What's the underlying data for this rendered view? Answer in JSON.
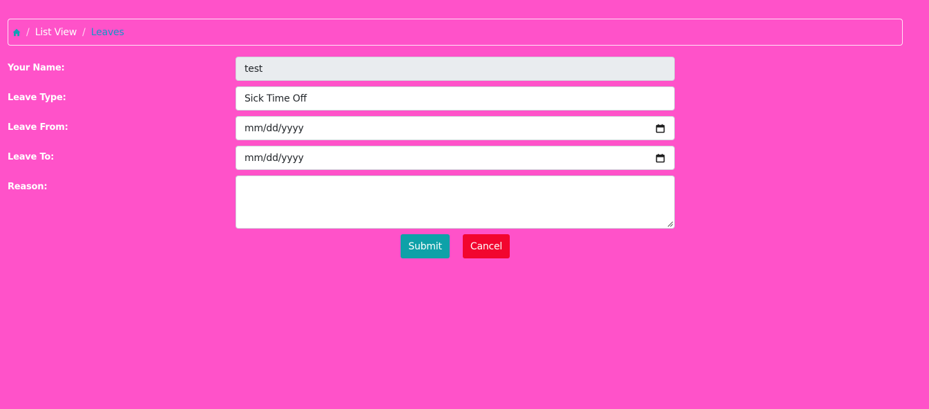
{
  "breadcrumb": {
    "home_icon": "home-icon",
    "separator": "/",
    "items": [
      {
        "label": "List View"
      },
      {
        "label": "Leaves"
      }
    ]
  },
  "form": {
    "name": {
      "label": "Your Name:",
      "value": "test"
    },
    "leave_type": {
      "label": "Leave Type:",
      "value": "Sick Time Off"
    },
    "leave_from": {
      "label": "Leave From:",
      "value": "mm/dd/yyyy",
      "icon": "calendar-icon"
    },
    "leave_to": {
      "label": "Leave To:",
      "value": "mm/dd/yyyy",
      "icon": "calendar-icon"
    },
    "reason": {
      "label": "Reason:",
      "value": ""
    }
  },
  "actions": {
    "submit_label": "Submit",
    "cancel_label": "Cancel"
  },
  "colors": {
    "background": "#ff52c9",
    "submit": "#0ea1a8",
    "cancel": "#f2062f",
    "active_crumb": "#1295c9"
  }
}
